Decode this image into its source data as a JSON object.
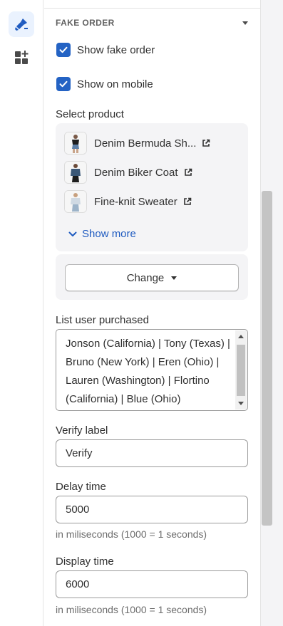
{
  "sidebar": {
    "icons": [
      {
        "name": "theme-brush-icon",
        "active": true
      },
      {
        "name": "add-app-block-icon",
        "active": false
      }
    ]
  },
  "section": {
    "title": "FAKE ORDER"
  },
  "settings": {
    "show_fake_order": {
      "label": "Show fake order",
      "checked": true
    },
    "show_on_mobile": {
      "label": "Show on mobile",
      "checked": true
    }
  },
  "product_picker": {
    "label": "Select product",
    "products": [
      {
        "name": "Denim Bermuda Sh..."
      },
      {
        "name": "Denim Biker Coat"
      },
      {
        "name": "Fine-knit Sweater"
      }
    ],
    "show_more": "Show more",
    "change_button": "Change"
  },
  "purchased_list": {
    "label": "List user purchased",
    "value": "Jonson (California) | Tony (Texas) | Bruno (New York) | Eren (Ohio) | Lauren (Washington) | Flortino (California) | Blue (Ohio)"
  },
  "verify_label": {
    "label": "Verify label",
    "value": "Verify"
  },
  "delay_time": {
    "label": "Delay time",
    "value": "5000",
    "help": "in miliseconds (1000 = 1 seconds)"
  },
  "display_time": {
    "label": "Display time",
    "value": "6000",
    "help": "in miliseconds (1000 = 1 seconds)"
  },
  "colors": {
    "accent": "#2463c4",
    "link": "#1f5bc0",
    "panel_bg": "#f4f4f6"
  }
}
